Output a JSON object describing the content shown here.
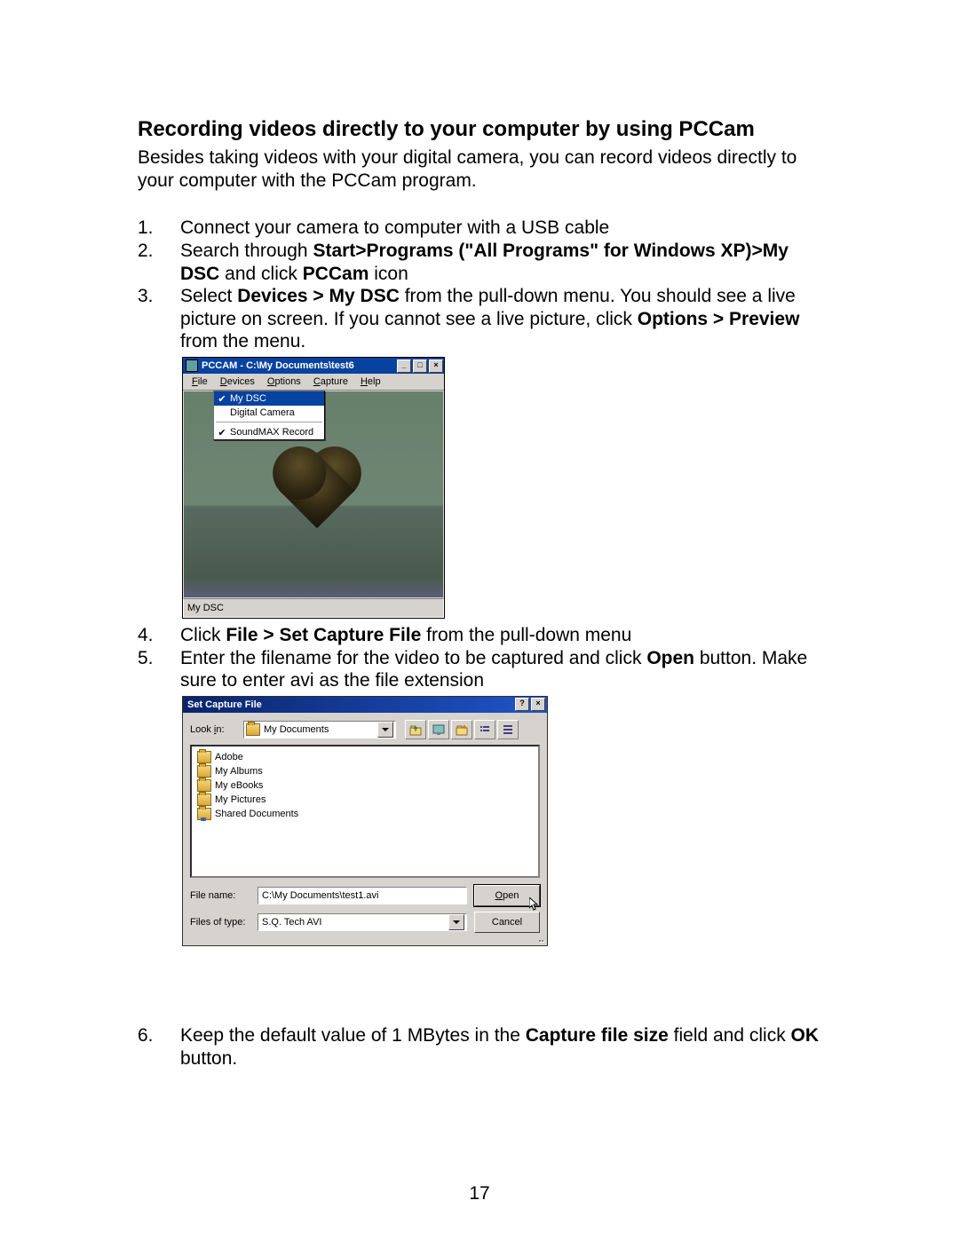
{
  "heading": "Recording videos directly to your computer by using PCCam",
  "intro": "Besides taking videos with your digital camera, you can record videos directly to your computer with the PCCam program.",
  "steps": {
    "s1": "Connect your camera to computer with a USB cable",
    "s2_a": "Search through ",
    "s2_b": "Start>Programs (\"All Programs\" for Windows XP)>My DSC",
    "s2_c": " and click ",
    "s2_d": "PCCam",
    "s2_e": " icon",
    "s3_a": "Select ",
    "s3_b": "Devices > My DSC",
    "s3_c": " from the pull-down menu. You should see a live picture on screen. If you cannot see a live picture, click ",
    "s3_d": "Options > Preview",
    "s3_e": " from the menu.",
    "s4_a": "Click ",
    "s4_b": "File > Set Capture File",
    "s4_c": " from the pull-down menu",
    "s5_a": "Enter the filename for the video to be captured and click ",
    "s5_b": "Open",
    "s5_c": " button. Make sure to enter avi as the file extension",
    "s6_a": "Keep the default value of 1 MBytes in the ",
    "s6_b": "Capture file size",
    "s6_c": " field and click ",
    "s6_d": "OK",
    "s6_e": " button."
  },
  "pccam": {
    "title": "PCCAM - C:\\My Documents\\test6",
    "menu": {
      "file": "File",
      "devices": "Devices",
      "options": "Options",
      "capture": "Capture",
      "help": "Help"
    },
    "devmenu": {
      "mydsc": "My DSC",
      "digicam": "Digital Camera",
      "soundmax": "SoundMAX Record"
    },
    "status": "My DSC"
  },
  "dlg": {
    "title": "Set Capture File",
    "lookin_label": "Look in:",
    "lookin_value": "My Documents",
    "folders": [
      "Adobe",
      "My Albums",
      "My eBooks",
      "My Pictures",
      "Shared Documents"
    ],
    "filename_label": "File name:",
    "filename_value": "C:\\My Documents\\test1.avi",
    "filetype_label": "Files of type:",
    "filetype_value": "S.Q. Tech AVI",
    "open": "Open",
    "cancel": "Cancel"
  },
  "page_number": "17"
}
